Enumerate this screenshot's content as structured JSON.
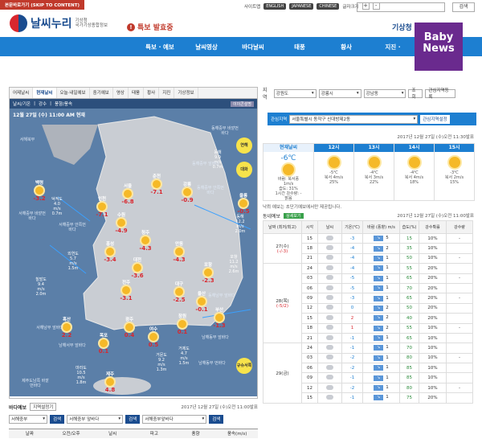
{
  "skip": "본문바로가기 (SKIP TO CONTENT)",
  "toplinks": {
    "sitemap": "사이트맵",
    "en": "ENGLISH",
    "jp": "JAPANESE",
    "cn": "CHINESE",
    "fontsize": "글자크기",
    "plus": "+",
    "minus": "-",
    "search_btn": "검색"
  },
  "logo": {
    "name": "날씨누리",
    "sub1": "기상청",
    "sub2": "국가기상종합정보"
  },
  "alert": {
    "icon": "!",
    "text": "특보 발효중"
  },
  "topright": "기상청",
  "nav": [
    "특보 · 예보",
    "날씨영상",
    "바다날씨",
    "태풍",
    "황사",
    "지진 · "
  ],
  "badge": {
    "l1": "Baby",
    "l2": "News"
  },
  "maptabs": [
    "어제날씨",
    "현재날씨",
    "오늘·내일예보",
    "중기예보",
    "영상",
    "태풍",
    "황사",
    "지진",
    "기상정보"
  ],
  "maptabs2": [
    "날씨/기온",
    "강수",
    "풍향/풍속"
  ],
  "maphelp": "이이콘설명",
  "maptime": "12월 27일 (수) 11:00 AM 현재",
  "mapbtns": [
    "연해",
    "대화"
  ],
  "cities": [
    {
      "n": "서울",
      "t": "-6.8"
    },
    {
      "n": "춘천",
      "t": "-7.1"
    },
    {
      "n": "강릉",
      "t": "-0.9"
    },
    {
      "n": "인천",
      "t": "-7.1"
    },
    {
      "n": "수원",
      "t": "-4.9"
    },
    {
      "n": "청주",
      "t": "-4.3"
    },
    {
      "n": "홍성",
      "t": "-3.4"
    },
    {
      "n": "대전",
      "t": "-3.6"
    },
    {
      "n": "안동",
      "t": "-4.3"
    },
    {
      "n": "전주",
      "t": "-3.1"
    },
    {
      "n": "대구",
      "t": "-2.5"
    },
    {
      "n": "포항",
      "t": "-2.3"
    },
    {
      "n": "울산",
      "t": "-0.1"
    },
    {
      "n": "부산",
      "t": "-1.3"
    },
    {
      "n": "광주",
      "t": "0.4"
    },
    {
      "n": "목포",
      "t": "0.1"
    },
    {
      "n": "여수",
      "t": "0.5"
    },
    {
      "n": "창원",
      "t": "0.1"
    },
    {
      "n": "흑산",
      "t": "2.2"
    },
    {
      "n": "제주",
      "t": "4.8"
    },
    {
      "n": "백령",
      "t": "-3.2"
    },
    {
      "n": "울릉",
      "t": "-0.5"
    }
  ],
  "seas": [
    {
      "n": "덕적도",
      "w": "4.0",
      "u": "m/s",
      "h": "0.7m"
    },
    {
      "n": "외연도",
      "w": "5.7",
      "u": "m/s",
      "h": "1.5m"
    },
    {
      "n": "칠발도",
      "w": "9.4",
      "u": "m/s",
      "h": "2.0m"
    },
    {
      "n": "동해",
      "w": "9.9",
      "u": "m/s",
      "h": "0.7m"
    },
    {
      "n": "동해",
      "w": "12.2",
      "u": "m/s",
      "h": "2.0m"
    },
    {
      "n": "포항",
      "w": "11.2",
      "u": "m/s",
      "h": "2.6m"
    },
    {
      "n": "거제도",
      "w": "4.7",
      "u": "m/s",
      "h": "1.5m"
    },
    {
      "n": "거문도",
      "w": "9.2",
      "u": "m/s",
      "h": "1.3m"
    },
    {
      "n": "마라도",
      "w": "10.5",
      "u": "m/s",
      "h": "1.8m"
    }
  ],
  "seanames": [
    "서해중부 안쪽먼바다",
    "서해중부 바깥먼바다",
    "서해남부 앞바다",
    "남해서부 앞바다",
    "제주도남쪽 바깥먼바다",
    "남해동부 앞바다",
    "동해중부 앞바다",
    "동해중부 안쪽먼바다",
    "동해중부 바깥먼바다",
    "동해남부 앞바다",
    "남해동부 먼바다",
    "대화퇴",
    "규슈서쪽",
    "서해북부"
  ],
  "region": {
    "label": "지역",
    "s1": "강원도",
    "s2": "강릉시",
    "s3": "강남동",
    "btn1": "조회",
    "btn2": "관심지역등록"
  },
  "interest": {
    "label": "관심지역",
    "value": "서울특별시 동작구 신대방제2동",
    "btn": "관심지역설정"
  },
  "pub1": "2017년 12월 27일 (수)오전 11:30발표",
  "now": {
    "h": "현재날씨",
    "t": "-6℃",
    "w1": "바람: 북서풍",
    "w2": "1m/s",
    "hum": "습도: 31%",
    "rain": "1시간 강수량: -",
    "sky": "맑음"
  },
  "hours": [
    {
      "h": "12시",
      "t": "-5℃",
      "w": "북서 4m/s",
      "r": "25%"
    },
    {
      "h": "13시",
      "t": "-4℃",
      "w": "북서 3m/s",
      "r": "22%"
    },
    {
      "h": "14시",
      "t": "-4℃",
      "w": "북서 4m/s",
      "r": "18%"
    },
    {
      "h": "15시",
      "t": "-3℃",
      "w": "북서 2m/s",
      "r": "15%"
    }
  ],
  "note": "낙뢰 예보는 초단기예보에서만 제공됩니다.",
  "dong": {
    "title": "동네예보",
    "badge": "상세보기",
    "pub": "2017년 12월 27일 (수)오전 11:00발표"
  },
  "dtheads": [
    "날짜 (최저/최고)",
    "시각",
    "날씨",
    "기온(℃)",
    "바람 (풍향) m/s",
    "습도(%)",
    "강수확률",
    "강수량"
  ],
  "dtrows": [
    {
      "h": "15",
      "sky": "c",
      "t": "-3",
      "w": "5",
      "hu": "15",
      "p": "10%",
      "r": "-"
    },
    {
      "h": "18",
      "sky": "c",
      "t": "-4",
      "w": "2",
      "hu": "35",
      "p": "10%",
      "r": ""
    },
    {
      "h": "21",
      "sky": "c",
      "t": "-4",
      "w": "1",
      "hu": "50",
      "p": "10%",
      "r": "-"
    },
    {
      "h": "24",
      "sky": "c",
      "t": "-4",
      "w": "1",
      "hu": "55",
      "p": "20%",
      "r": ""
    },
    {
      "h": "03",
      "sky": "c",
      "t": "-5",
      "w": "1",
      "hu": "65",
      "p": "20%",
      "r": "-"
    },
    {
      "h": "06",
      "sky": "c",
      "t": "-5",
      "w": "1",
      "hu": "70",
      "p": "20%",
      "r": ""
    },
    {
      "h": "09",
      "sky": "c",
      "t": "-3",
      "w": "1",
      "hu": "65",
      "p": "20%",
      "r": "-"
    },
    {
      "h": "12",
      "sky": "c",
      "t": "0",
      "w": "2",
      "hu": "50",
      "p": "20%",
      "r": ""
    },
    {
      "h": "15",
      "sky": "c",
      "t": "2",
      "w": "2",
      "hu": "40",
      "p": "20%",
      "r": ""
    },
    {
      "h": "18",
      "sky": "c",
      "t": "1",
      "w": "2",
      "hu": "55",
      "p": "10%",
      "r": "-"
    },
    {
      "h": "21",
      "sky": "c",
      "t": "-1",
      "w": "1",
      "hu": "65",
      "p": "10%",
      "r": ""
    },
    {
      "h": "24",
      "sky": "c",
      "t": "-1",
      "w": "1",
      "hu": "70",
      "p": "10%",
      "r": ""
    },
    {
      "h": "03",
      "sky": "c",
      "t": "-2",
      "w": "1",
      "hu": "80",
      "p": "10%",
      "r": "-"
    },
    {
      "h": "06",
      "sky": "c",
      "t": "-2",
      "w": "1",
      "hu": "85",
      "p": "10%",
      "r": ""
    },
    {
      "h": "09",
      "sky": "c",
      "t": "-1",
      "w": "1",
      "hu": "85",
      "p": "10%",
      "r": ""
    },
    {
      "h": "12",
      "sky": "c",
      "t": "-2",
      "w": "1",
      "hu": "80",
      "p": "10%",
      "r": "-"
    },
    {
      "h": "15",
      "sky": "c",
      "t": "-1",
      "w": "1",
      "hu": "75",
      "p": "20%",
      "r": ""
    }
  ],
  "days": [
    {
      "d": "27(수)",
      "mm": "(-/-3)"
    },
    {
      "d": "28(목)",
      "mm": "(-5/2)"
    },
    {
      "d": "29(금)",
      "mm": ""
    }
  ],
  "seafc": {
    "title": "바다예보",
    "btn": "지역설정기",
    "pub": "2017년 12월 27일 (수)오전 11:00발표",
    "s1": "서해중부",
    "s2": "서해중부 앞바다",
    "s3": "서해중부앞바다",
    "go": "검색",
    "cols": [
      "날짜",
      "오전/오후",
      "날씨",
      "파고",
      "풍향",
      "풍속(m/s)"
    ]
  }
}
